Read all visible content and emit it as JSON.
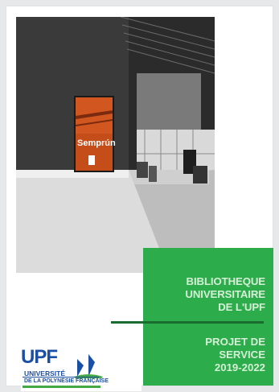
{
  "cover": {
    "title_lines": [
      "BIBLIOTHEQUE",
      "UNIVERSITAIRE",
      "DE L'UPF"
    ],
    "subtitle_lines": [
      "PROJET DE",
      "SERVICE",
      "2019-2022"
    ],
    "photo_book_title": "Semprún",
    "logo": {
      "acronym": "UPF",
      "line1": "UNIVERSITÉ",
      "line2": "DE LA POLYNÉSIE FRANÇAISE"
    }
  }
}
